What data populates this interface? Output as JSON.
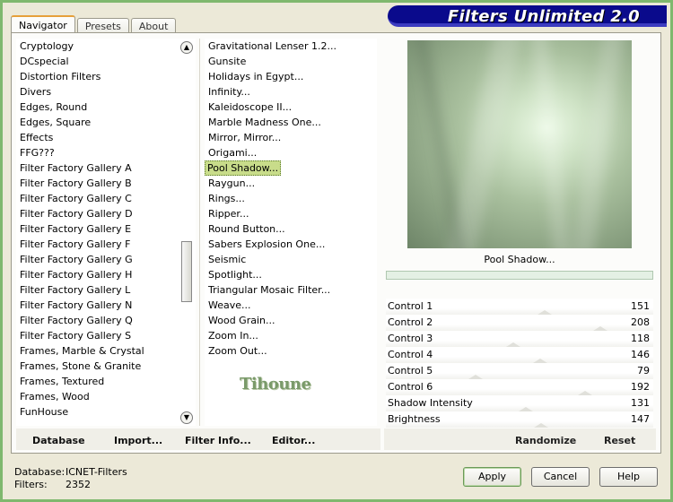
{
  "app": {
    "title": "Filters Unlimited 2.0"
  },
  "tabs": [
    {
      "label": "Navigator",
      "active": true
    },
    {
      "label": "Presets",
      "active": false
    },
    {
      "label": "About",
      "active": false
    }
  ],
  "categories": [
    "Cryptology",
    "DCspecial",
    "Distortion Filters",
    "Divers",
    "Edges, Round",
    "Edges, Square",
    "Effects",
    "FFG???",
    "Filter Factory Gallery A",
    "Filter Factory Gallery B",
    "Filter Factory Gallery C",
    "Filter Factory Gallery D",
    "Filter Factory Gallery E",
    "Filter Factory Gallery F",
    "Filter Factory Gallery G",
    "Filter Factory Gallery H",
    "Filter Factory Gallery L",
    "Filter Factory Gallery N",
    "Filter Factory Gallery Q",
    "Filter Factory Gallery S",
    "Frames, Marble & Crystal",
    "Frames, Stone & Granite",
    "Frames, Textured",
    "Frames, Wood",
    "FunHouse"
  ],
  "filters": [
    "Gravitational Lenser 1.2...",
    "Gunsite",
    "Holidays in Egypt...",
    "Infinity...",
    "Kaleidoscope II...",
    "Marble Madness One...",
    "Mirror, Mirror...",
    "Origami...",
    "Pool Shadow...",
    "Raygun...",
    "Rings...",
    "Ripper...",
    "Round Button...",
    "Sabers Explosion One...",
    "Seismic",
    "Spotlight...",
    "Triangular Mosaic Filter...",
    "Weave...",
    "Wood Grain...",
    "Zoom In...",
    "Zoom Out..."
  ],
  "selected_filter": "Pool Shadow...",
  "logo_text": "Tihoune",
  "list_buttons": {
    "database": "Database",
    "import": "Import...",
    "filter_info": "Filter Info...",
    "editor": "Editor..."
  },
  "preview": {
    "filter_name": "Pool Shadow..."
  },
  "controls": [
    {
      "label": "Control 1",
      "value": 151
    },
    {
      "label": "Control 2",
      "value": 208
    },
    {
      "label": "Control 3",
      "value": 118
    },
    {
      "label": "Control 4",
      "value": 146
    },
    {
      "label": "Control 5",
      "value": 79
    },
    {
      "label": "Control 6",
      "value": 192
    },
    {
      "label": "Shadow Intensity",
      "value": 131
    },
    {
      "label": "Brightness",
      "value": 147
    }
  ],
  "control_buttons": {
    "randomize": "Randomize",
    "reset": "Reset"
  },
  "footer": {
    "database_label": "Database:",
    "database_value": "ICNET-Filters",
    "filters_label": "Filters:",
    "filters_value": "2352"
  },
  "dialog_buttons": {
    "apply": "Apply",
    "cancel": "Cancel",
    "help": "Help"
  }
}
